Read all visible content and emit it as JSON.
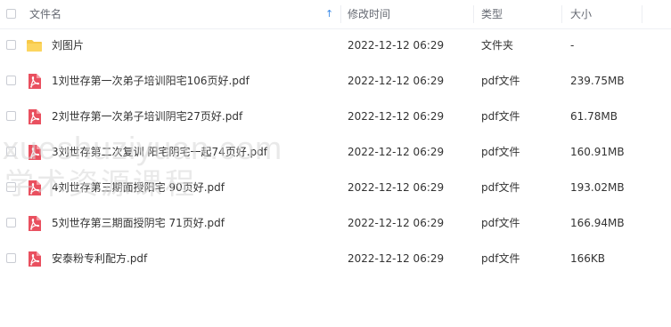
{
  "header": {
    "name_label": "文件名",
    "time_label": "修改时间",
    "type_label": "类型",
    "size_label": "大小",
    "sort_arrow": "↑"
  },
  "files": [
    {
      "name": "刘图片",
      "modified": "2022-12-12 06:29",
      "type": "文件夹",
      "size": "-",
      "icon": "folder-icon"
    },
    {
      "name": "1刘世存第一次弟子培训阳宅106页好.pdf",
      "modified": "2022-12-12 06:29",
      "type": "pdf文件",
      "size": "239.75MB",
      "icon": "pdf-icon"
    },
    {
      "name": "2刘世存第一次弟子培训阴宅27页好.pdf",
      "modified": "2022-12-12 06:29",
      "type": "pdf文件",
      "size": "61.78MB",
      "icon": "pdf-icon"
    },
    {
      "name": "3刘世存第二次复训 阳宅阴宅一起74页好.pdf",
      "modified": "2022-12-12 06:29",
      "type": "pdf文件",
      "size": "160.91MB",
      "icon": "pdf-icon"
    },
    {
      "name": "4刘世存第三期面授阳宅 90页好.pdf",
      "modified": "2022-12-12 06:29",
      "type": "pdf文件",
      "size": "193.02MB",
      "icon": "pdf-icon"
    },
    {
      "name": "5刘世存第三期面授阴宅 71页好.pdf",
      "modified": "2022-12-12 06:29",
      "type": "pdf文件",
      "size": "166.94MB",
      "icon": "pdf-icon"
    },
    {
      "name": "安泰粉专利配方.pdf",
      "modified": "2022-12-12 06:29",
      "type": "pdf文件",
      "size": "166KB",
      "icon": "pdf-icon"
    }
  ],
  "watermark": {
    "line1": "xueshuziyuan.com",
    "line2": "学术资源课程"
  },
  "colors": {
    "folder": "#f7c948",
    "pdf": "#e9505f",
    "accent": "#3d8be8"
  }
}
